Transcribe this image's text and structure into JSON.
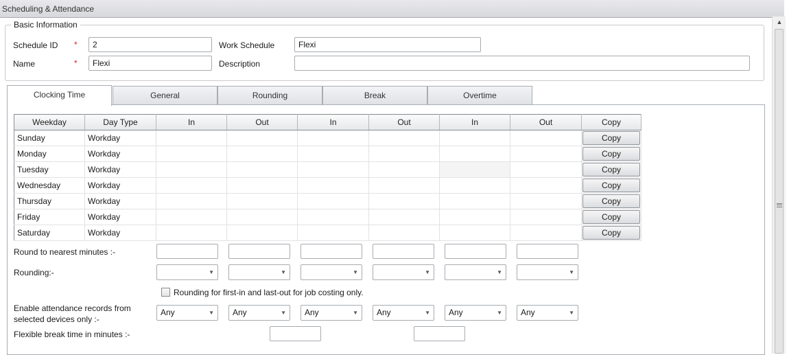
{
  "window": {
    "title": "Scheduling & Attendance"
  },
  "basic_info": {
    "legend": "Basic Information",
    "schedule_id_label": "Schedule ID",
    "schedule_id_value": "2",
    "name_label": "Name",
    "name_value": "Flexi",
    "work_schedule_label": "Work Schedule",
    "work_schedule_value": "Flexi",
    "description_label": "Description",
    "description_value": "",
    "required_marker": "*"
  },
  "tabs": [
    {
      "label": "Clocking Time",
      "active": true
    },
    {
      "label": "General",
      "active": false
    },
    {
      "label": "Rounding",
      "active": false
    },
    {
      "label": "Break",
      "active": false
    },
    {
      "label": "Overtime",
      "active": false
    }
  ],
  "grid": {
    "headers": [
      "Weekday",
      "Day Type",
      "In",
      "Out",
      "In",
      "Out",
      "In",
      "Out",
      "Copy"
    ],
    "copy_label": "Copy",
    "rows": [
      {
        "weekday": "Sunday",
        "day_type": "Workday"
      },
      {
        "weekday": "Monday",
        "day_type": "Workday"
      },
      {
        "weekday": "Tuesday",
        "day_type": "Workday"
      },
      {
        "weekday": "Wednesday",
        "day_type": "Workday"
      },
      {
        "weekday": "Thursday",
        "day_type": "Workday"
      },
      {
        "weekday": "Friday",
        "day_type": "Workday"
      },
      {
        "weekday": "Saturday",
        "day_type": "Workday"
      }
    ]
  },
  "options": {
    "round_nearest_label": "Round to nearest minutes :-",
    "rounding_label": "Rounding:-",
    "rounding_checkbox_label": "Rounding for first-in and last-out for job costing only.",
    "rounding_checkbox_checked": false,
    "devices_label_1": "Enable attendance records from",
    "devices_label_2": "selected devices only :-",
    "devices_values": [
      "Any",
      "Any",
      "Any",
      "Any",
      "Any",
      "Any"
    ],
    "flex_break_label": "Flexible break time in minutes :-"
  }
}
